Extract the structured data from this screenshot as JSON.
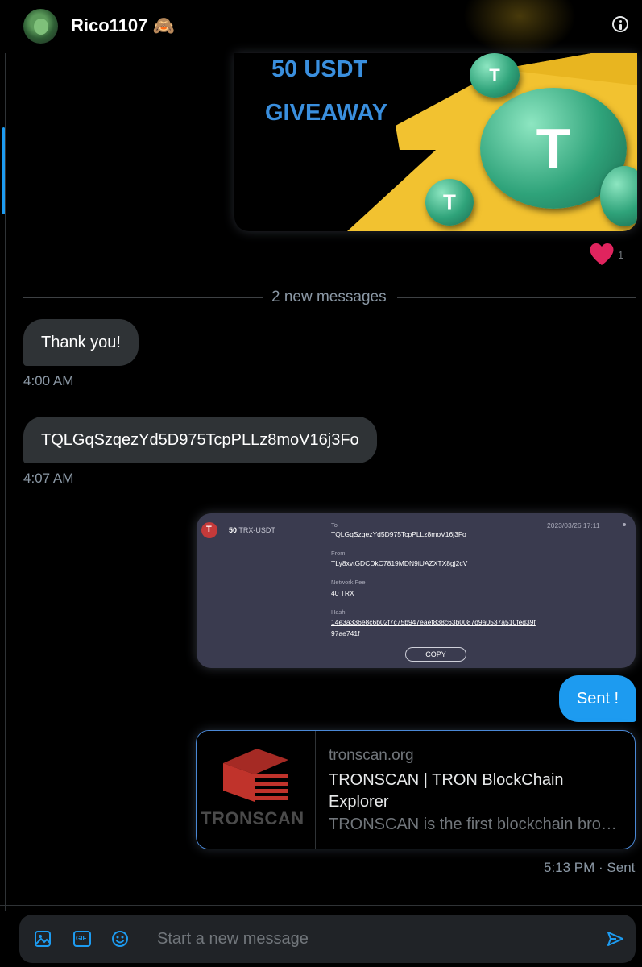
{
  "header": {
    "username": "Rico1107 🙈",
    "info_icon": "info-icon"
  },
  "promo_image": {
    "line1": "50 USDT",
    "line2": "GIVEAWAY",
    "coin_symbol": "T"
  },
  "reaction": {
    "icon": "heart-icon",
    "count": "1"
  },
  "divider": {
    "label": "2 new messages"
  },
  "messages": [
    {
      "text": "Thank you!",
      "time": "4:00 AM"
    },
    {
      "text": "TQLGqSzqezYd5D975TcpPLLz8moV16j3Fo",
      "time": "4:07 AM"
    }
  ],
  "transaction": {
    "amount": "50",
    "token": "TRX-USDT",
    "date": "2023/03/26 17:11",
    "to_label": "To",
    "to_value": "TQLGqSzqezYd5D975TcpPLLz8moV16j3Fo",
    "from_label": "From",
    "from_value": "TLy8xvtGDCDkC7819MDN9iUAZXTX8gj2cV",
    "fee_label": "Network Fee",
    "fee_value": "40 TRX",
    "hash_label": "Hash",
    "hash_line1": "14e3a336e8c6b02f7c75b947eaef838c63b0087d9a0537a510fed39f",
    "hash_line2": "97ae741f",
    "copy_label": "COPY"
  },
  "sent_message": {
    "text": "Sent !"
  },
  "link_card": {
    "thumb_text": "TRONSCAN",
    "domain": "tronscan.org",
    "title": "TRONSCAN | TRON BlockChain Explorer",
    "description": "TRONSCAN is the first blockchain bro…"
  },
  "sent_status": "5:13 PM · Sent",
  "composer": {
    "placeholder": "Start a new message",
    "gif_label": "GIF"
  },
  "colors": {
    "accent": "#1d9bf0",
    "bubble_incoming": "#2f3336",
    "tx_card": "#3a3b4f",
    "heart": "#e0245e"
  }
}
